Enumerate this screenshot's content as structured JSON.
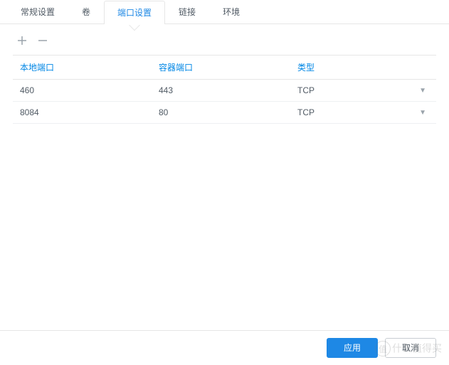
{
  "tabs": [
    {
      "label": "常规设置"
    },
    {
      "label": "卷"
    },
    {
      "label": "端口设置"
    },
    {
      "label": "链接"
    },
    {
      "label": "环境"
    }
  ],
  "active_tab_index": 2,
  "columns": {
    "local_port": "本地端口",
    "container_port": "容器端口",
    "type": "类型"
  },
  "rows": [
    {
      "local": "460",
      "container": "443",
      "type": "TCP"
    },
    {
      "local": "8084",
      "container": "80",
      "type": "TCP"
    }
  ],
  "buttons": {
    "apply": "应用",
    "cancel": "取消"
  },
  "watermark": {
    "badge": "值",
    "text": "什么值得买"
  }
}
